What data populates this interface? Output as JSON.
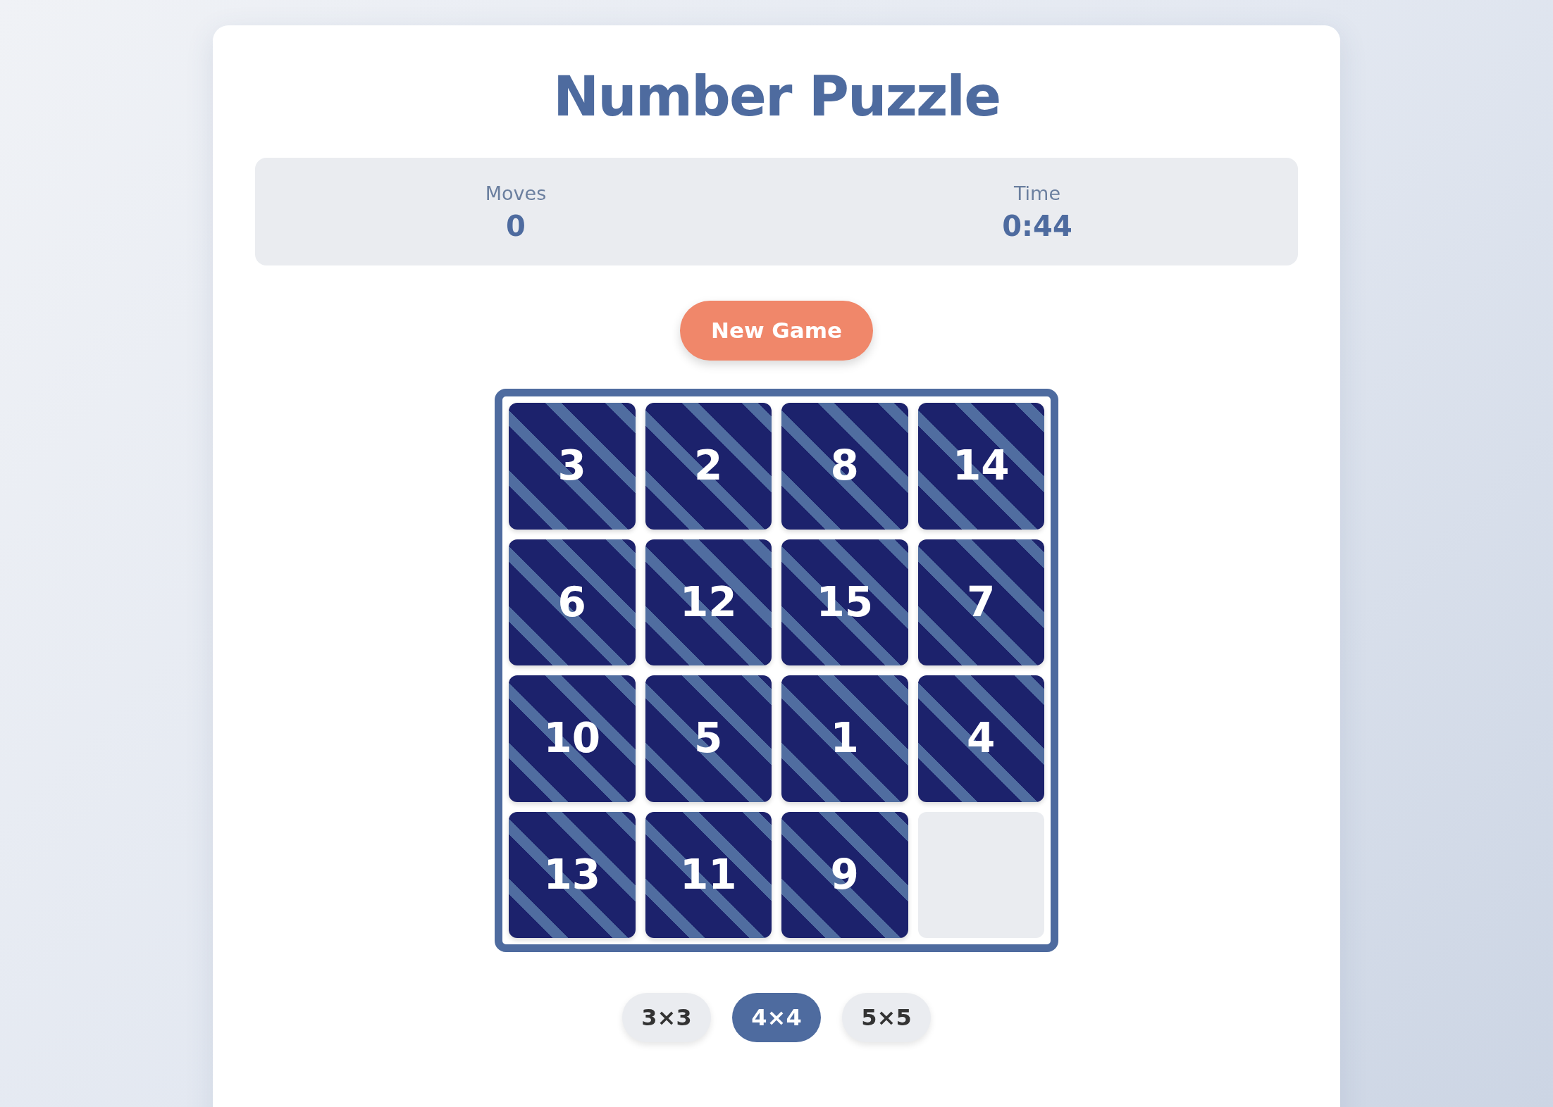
{
  "title": "Number Puzzle",
  "stats": [
    {
      "label": "Moves",
      "value": "0"
    },
    {
      "label": "Time",
      "value": "0:44"
    }
  ],
  "new_game_button": "New Game",
  "board": {
    "tiles": [
      {
        "kind": "number",
        "label": "3"
      },
      {
        "kind": "number",
        "label": "2"
      },
      {
        "kind": "number",
        "label": "8"
      },
      {
        "kind": "number",
        "label": "14"
      },
      {
        "kind": "number",
        "label": "6"
      },
      {
        "kind": "number",
        "label": "12"
      },
      {
        "kind": "number",
        "label": "15"
      },
      {
        "kind": "number",
        "label": "7"
      },
      {
        "kind": "number",
        "label": "10"
      },
      {
        "kind": "number",
        "label": "5"
      },
      {
        "kind": "number",
        "label": "1"
      },
      {
        "kind": "number",
        "label": "4"
      },
      {
        "kind": "number",
        "label": "13"
      },
      {
        "kind": "number",
        "label": "11"
      },
      {
        "kind": "number",
        "label": "9"
      },
      {
        "kind": "empty"
      }
    ]
  },
  "sizes": [
    {
      "label": "3×3",
      "selected": false
    },
    {
      "label": "4×4",
      "selected": true
    },
    {
      "label": "5×5",
      "selected": false
    }
  ]
}
